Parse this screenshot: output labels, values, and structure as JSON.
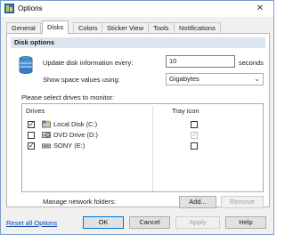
{
  "window": {
    "title": "Options",
    "close_glyph": "✕"
  },
  "tabs": [
    {
      "label": "General"
    },
    {
      "label": "Disks"
    },
    {
      "label": "Colors"
    },
    {
      "label": "Sticker View"
    },
    {
      "label": "Tools"
    },
    {
      "label": "Notifications"
    }
  ],
  "active_tab": "Disks",
  "disk_options": {
    "section_title": "Disk options",
    "update_label": "Update disk information every:",
    "update_value": "10",
    "update_unit": "seconds",
    "space_label": "Show space values using:",
    "space_value": "Gigabytes",
    "drives_prompt": "Please select drives to monitor:",
    "columns": {
      "drives": "Drives",
      "tray": "Tray icon"
    },
    "drives": [
      {
        "label": "Local Disk (C:)",
        "monitored": true,
        "tray": false,
        "tray_enabled": true,
        "icon": "hard-disk-icon"
      },
      {
        "label": "DVD Drive (D:)",
        "monitored": false,
        "tray": true,
        "tray_enabled": false,
        "icon": "dvd-drive-icon"
      },
      {
        "label": "SONY (E:)",
        "monitored": true,
        "tray": false,
        "tray_enabled": true,
        "icon": "removable-drive-icon"
      }
    ],
    "network_label": "Manage network folders:",
    "add_button": "Add...",
    "remove_button": "Remove"
  },
  "footer": {
    "reset_link": "Reset all Options",
    "ok": "OK",
    "cancel": "Cancel",
    "apply": "Apply",
    "help": "Help"
  },
  "colors": {
    "accent": "#0078d7",
    "section_bg": "#dde5ef",
    "link": "#0645ad"
  }
}
